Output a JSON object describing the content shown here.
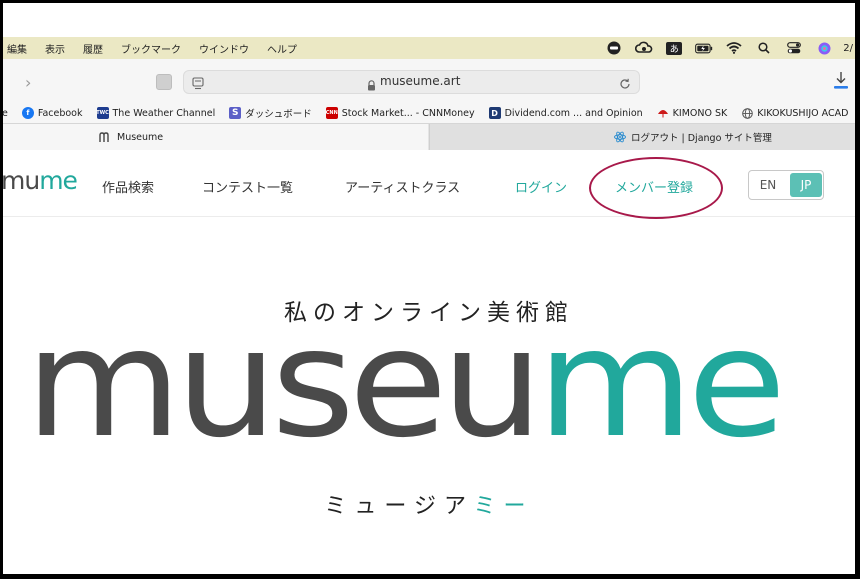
{
  "menubar": {
    "items": [
      "編集",
      "表示",
      "履歴",
      "ブックマーク",
      "ウインドウ",
      "ヘルプ"
    ],
    "ime_label": "あ",
    "time_fragment": "2/"
  },
  "toolbar": {
    "url": "museume.art"
  },
  "bookmarks": [
    {
      "label": "e",
      "icon": "none"
    },
    {
      "label": "Facebook",
      "icon": "facebook-icon"
    },
    {
      "label": "The Weather Channel",
      "icon": "weather-channel-icon"
    },
    {
      "label": "ダッシュボード",
      "icon": "dashboard-s-icon"
    },
    {
      "label": "Stock Market... - CNNMoney",
      "icon": "cnn-icon"
    },
    {
      "label": "Dividend.com ... and Opinion",
      "icon": "dividend-icon"
    },
    {
      "label": "KIMONO SK",
      "icon": "kimono-icon"
    },
    {
      "label": "KIKOKUSHIJO ACAD",
      "icon": "globe-icon"
    }
  ],
  "tabs": [
    {
      "label": "Museume",
      "active": true
    },
    {
      "label": "ログアウト | Django サイト管理",
      "active": false
    }
  ],
  "site": {
    "logo_part1": "mu",
    "logo_part2": "me",
    "nav": [
      "作品検索",
      "コンテスト一覧",
      "アーティストクラス",
      "ログイン",
      "メンバー登録"
    ],
    "lang_en": "EN",
    "lang_jp": "JP"
  },
  "hero": {
    "tagline": "私のオンライン美術館",
    "logo_dark": "museu",
    "logo_teal": "me",
    "sub_dark": "ミュージア",
    "sub_teal": "ミー"
  },
  "colors": {
    "teal": "#21a89c",
    "dark": "#4a4a4a",
    "annotation_circle": "#a8194a",
    "menubar": "#ebe8c4"
  }
}
